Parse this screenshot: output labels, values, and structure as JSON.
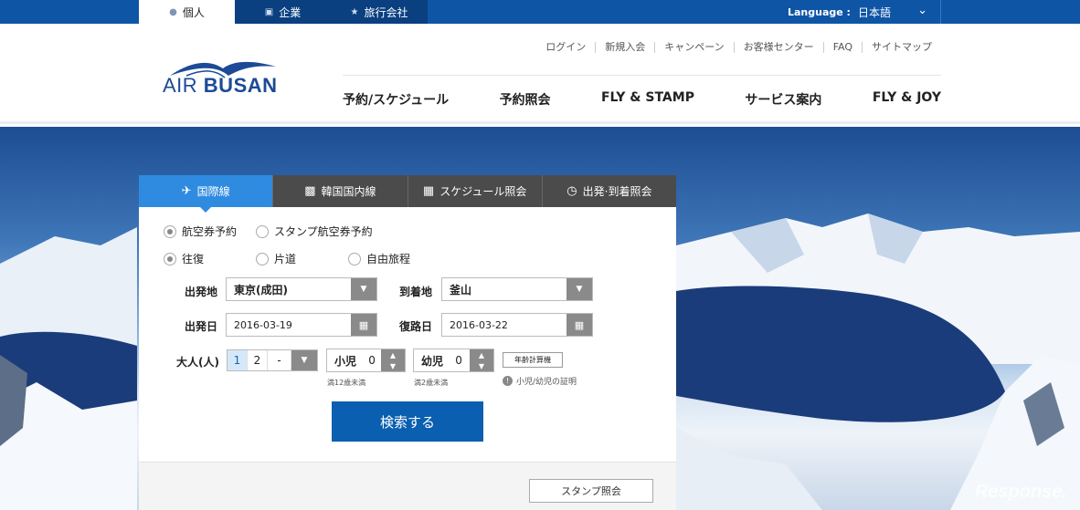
{
  "topbar": {
    "segments": [
      {
        "label": "個人",
        "icon": "person-icon"
      },
      {
        "label": "企業",
        "icon": "building-icon"
      },
      {
        "label": "旅行会社",
        "icon": "star-icon"
      }
    ],
    "language_label": "Language :",
    "language_value": "日本語"
  },
  "header": {
    "logo": {
      "text_light": "AIR ",
      "text_bold": "BUSAN"
    },
    "util_links": [
      "ログイン",
      "新規入会",
      "キャンペーン",
      "お客様センター",
      "FAQ",
      "サイトマップ"
    ],
    "gnb": [
      "予約/スケジュール",
      "予約照会",
      "FLY & STAMP",
      "サービス案内",
      "FLY & JOY"
    ]
  },
  "booking": {
    "tabs": [
      {
        "label": "国際線",
        "icon": "airplane-icon",
        "active": true
      },
      {
        "label": "韓国国内線",
        "icon": "suitcase-icon",
        "active": false
      },
      {
        "label": "スケジュール照会",
        "icon": "calendar-icon",
        "active": false
      },
      {
        "label": "出発·到着照会",
        "icon": "clock-icon",
        "active": false
      }
    ],
    "ticket_type": {
      "options": [
        "航空券予約",
        "スタンプ航空券予約"
      ],
      "selected": 0
    },
    "trip_type": {
      "options": [
        "往復",
        "片道",
        "自由旅程"
      ],
      "selected": 0
    },
    "departure_label": "出発地",
    "departure_value": "東京(成田)",
    "arrival_label": "到着地",
    "arrival_value": "釜山",
    "depart_date_label": "出発日",
    "depart_date_value": "2016-03-19",
    "return_date_label": "復路日",
    "return_date_value": "2016-03-22",
    "adult_label": "大人(人)",
    "adult_options": [
      "1",
      "2",
      "-"
    ],
    "adult_selected": "1",
    "child_label": "小児",
    "child_count": "0",
    "child_note": "満12歳未満",
    "infant_label": "幼児",
    "infant_count": "0",
    "infant_note": "満2歳未満",
    "age_calc_label": "年齢計算機",
    "proof_label": "小児/幼児の証明",
    "search_label": "検索する",
    "stamp_query_label": "スタンプ照会"
  },
  "watermark": "Response.",
  "colors": {
    "brand_blue": "#0f55a6",
    "tab_active": "#2f8be0",
    "search_button": "#0a5fb0"
  }
}
